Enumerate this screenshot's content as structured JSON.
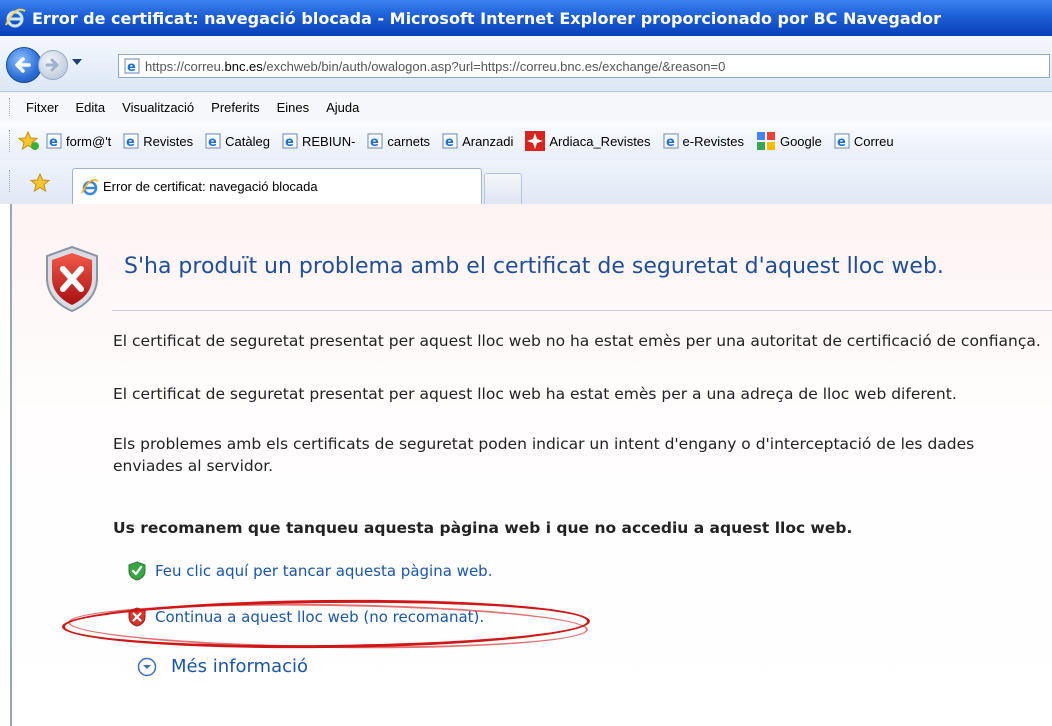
{
  "window": {
    "title": "Error de certificat: navegació blocada - Microsoft Internet Explorer proporcionado por BC Navegador"
  },
  "address_bar": {
    "url_prefix": "https://correu.",
    "url_host": "bnc.es",
    "url_suffix": "/exchweb/bin/auth/owalogon.asp?url=https://correu.bnc.es/exchange/&reason=0"
  },
  "menu": {
    "items": [
      "Fitxer",
      "Edita",
      "Visualització",
      "Preferits",
      "Eines",
      "Ajuda"
    ]
  },
  "favorites": {
    "items": [
      {
        "label": "form@'t",
        "icon": "ie-page-icon"
      },
      {
        "label": "Revistes",
        "icon": "ie-page-icon"
      },
      {
        "label": "Catàleg",
        "icon": "ie-page-icon"
      },
      {
        "label": "REBIUN-",
        "icon": "ie-page-icon"
      },
      {
        "label": "carnets",
        "icon": "ie-page-icon"
      },
      {
        "label": "Aranzadi",
        "icon": "ie-page-icon"
      },
      {
        "label": "Ardiaca_Revistes",
        "icon": "ardiaca-icon"
      },
      {
        "label": "e-Revistes",
        "icon": "ie-page-icon"
      },
      {
        "label": "Google",
        "icon": "google-icon"
      },
      {
        "label": "Correu",
        "icon": "ie-page-icon"
      }
    ]
  },
  "tabs": {
    "active_label": "Error de certificat: navegació blocada"
  },
  "page": {
    "headline": "S'ha produït un problema amb el certificat de seguretat d'aquest lloc web.",
    "para1_line1": "El certificat de seguretat presentat per aquest lloc web no ha estat emès per una autoritat de certificació de confiança.",
    "para1_line2": "El certificat de seguretat presentat per aquest lloc web ha estat emès per a una adreça de lloc web diferent.",
    "para2": "Els problemes amb els certificats de seguretat poden indicar un intent d'engany o d'interceptació de les dades enviades al servidor.",
    "recommendation": "Us recomanem que tanqueu aquesta pàgina web i que no accediu a aquest lloc web.",
    "close_link": "Feu clic aquí per tancar aquesta pàgina web.",
    "continue_link": "Continua a aquest lloc web (no recomanat).",
    "more_info": "Més informació"
  },
  "colors": {
    "titlebar": "#1d5fd6",
    "headline": "#1f4e99",
    "link": "#1a55a7",
    "annotation": "#d01616"
  }
}
